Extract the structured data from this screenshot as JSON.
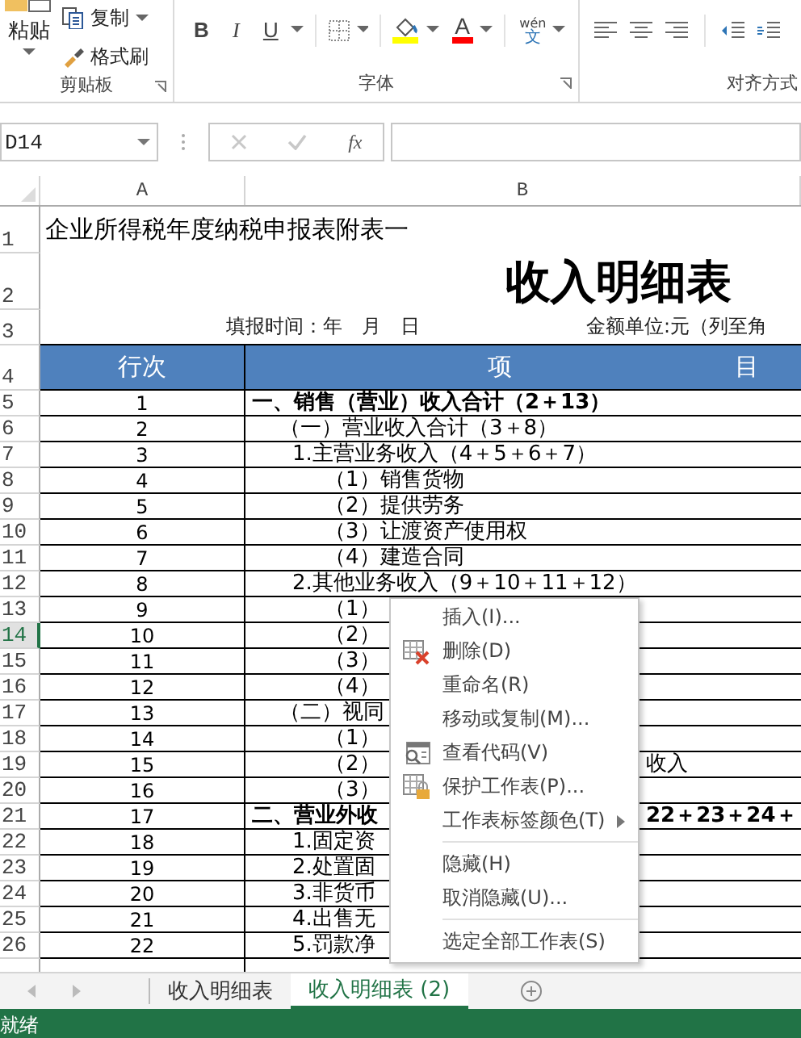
{
  "ribbon": {
    "clipboard": {
      "paste": "粘贴",
      "copy": "复制",
      "format_painter": "格式刷",
      "label": "剪贴板"
    },
    "font": {
      "bold": "B",
      "italic": "I",
      "underline": "U",
      "font_color": "A",
      "phonetic": "wén",
      "phonetic_char": "文",
      "label": "字体"
    },
    "alignment": {
      "label": "对齐方式"
    }
  },
  "formula_bar": {
    "name_box": "D14",
    "function": "fx"
  },
  "columns": [
    "A",
    "B"
  ],
  "rows": [
    {
      "header": "1",
      "selected": false,
      "kind": "caption",
      "text": "企业所得税年度纳税申报表附表一"
    },
    {
      "header": "2",
      "selected": false,
      "kind": "title",
      "text": "收入明细表"
    },
    {
      "header": "3",
      "selected": false,
      "kind": "info",
      "date": "填报时间：年　月　日",
      "unit": "金额单位:元（列至角"
    },
    {
      "header": "4",
      "selected": false,
      "kind": "heading",
      "a": "行次",
      "b1": "项",
      "b2": "目"
    },
    {
      "header": "5",
      "selected": false,
      "kind": "section",
      "line": "1",
      "item": "一、销售（营业）收入合计（2＋13）"
    },
    {
      "header": "6",
      "selected": false,
      "kind": "group",
      "line": "2",
      "item": "（一）营业收入合计（3＋8）"
    },
    {
      "header": "7",
      "selected": false,
      "kind": "item",
      "line": "3",
      "item": "1.主营业务收入（4＋5＋6＋7）"
    },
    {
      "header": "8",
      "selected": false,
      "kind": "sub",
      "line": "4",
      "item": "（1）销售货物"
    },
    {
      "header": "9",
      "selected": false,
      "kind": "sub",
      "line": "5",
      "item": "（2）提供劳务"
    },
    {
      "header": "10",
      "selected": false,
      "kind": "sub",
      "line": "6",
      "item": "（3）让渡资产使用权"
    },
    {
      "header": "11",
      "selected": false,
      "kind": "sub",
      "line": "7",
      "item": "（4）建造合同"
    },
    {
      "header": "12",
      "selected": false,
      "kind": "item",
      "line": "8",
      "item": "2.其他业务收入（9＋10＋11＋12）"
    },
    {
      "header": "13",
      "selected": false,
      "kind": "sub",
      "line": "9",
      "item": "（1）"
    },
    {
      "header": "14",
      "selected": true,
      "kind": "sub",
      "line": "10",
      "item": "（2）"
    },
    {
      "header": "15",
      "selected": false,
      "kind": "sub",
      "line": "11",
      "item": "（3）"
    },
    {
      "header": "16",
      "selected": false,
      "kind": "sub",
      "line": "12",
      "item": "（4）"
    },
    {
      "header": "17",
      "selected": false,
      "kind": "group",
      "line": "13",
      "item": "（二）视同"
    },
    {
      "header": "18",
      "selected": false,
      "kind": "sub",
      "line": "14",
      "item": "（1）"
    },
    {
      "header": "19",
      "selected": false,
      "kind": "sub",
      "line": "15",
      "item": "（2）",
      "item_right": "收入"
    },
    {
      "header": "20",
      "selected": false,
      "kind": "sub",
      "line": "16",
      "item": "（3）"
    },
    {
      "header": "21",
      "selected": false,
      "kind": "section",
      "line": "17",
      "item": "二、营业外收",
      "item_right": "22＋23＋24＋"
    },
    {
      "header": "22",
      "selected": false,
      "kind": "item",
      "line": "18",
      "item": "1.固定资"
    },
    {
      "header": "23",
      "selected": false,
      "kind": "item",
      "line": "19",
      "item": "2.处置固"
    },
    {
      "header": "24",
      "selected": false,
      "kind": "item",
      "line": "20",
      "item": "3.非货币"
    },
    {
      "header": "25",
      "selected": false,
      "kind": "item",
      "line": "21",
      "item": "4.出售无"
    },
    {
      "header": "26",
      "selected": false,
      "kind": "item",
      "line": "22",
      "item": "5.罚款净"
    }
  ],
  "context_menu": [
    {
      "label": "插入(I)...",
      "kind": "plain",
      "separator_before": false,
      "submenu": false
    },
    {
      "label": "删除(D)",
      "kind": "delete",
      "separator_before": false,
      "submenu": false
    },
    {
      "label": "重命名(R)",
      "kind": "plain",
      "separator_before": false,
      "submenu": false
    },
    {
      "label": "移动或复制(M)...",
      "kind": "plain",
      "separator_before": false,
      "submenu": false
    },
    {
      "label": "查看代码(V)",
      "kind": "code",
      "separator_before": false,
      "submenu": false
    },
    {
      "label": "保护工作表(P)...",
      "kind": "protect",
      "separator_before": false,
      "submenu": false
    },
    {
      "label": "工作表标签颜色(T)",
      "kind": "plain",
      "separator_before": false,
      "submenu": true
    },
    {
      "label": "隐藏(H)",
      "kind": "plain",
      "separator_before": true,
      "submenu": false
    },
    {
      "label": "取消隐藏(U)...",
      "kind": "plain",
      "separator_before": false,
      "submenu": false
    },
    {
      "label": "选定全部工作表(S)",
      "kind": "plain",
      "separator_before": true,
      "submenu": false
    }
  ],
  "sheet_tabs": [
    {
      "label": "收入明细表",
      "selected": false
    },
    {
      "label": "收入明细表 (2)",
      "selected": true
    }
  ],
  "status_bar": {
    "text": "就绪"
  }
}
